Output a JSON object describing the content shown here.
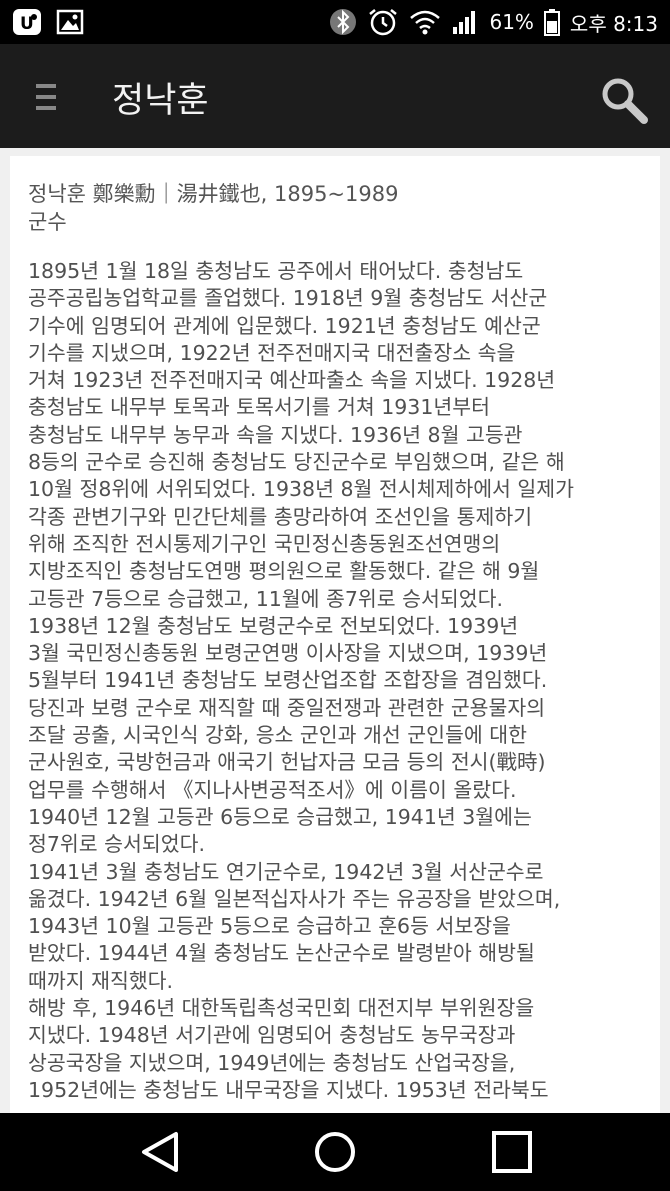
{
  "status_bar": {
    "battery_percent": "61%",
    "time": "오후 8:13",
    "icons": [
      "notification-app-icon",
      "gallery-icon",
      "bluetooth-icon",
      "alarm-icon",
      "wifi-icon",
      "signal-icon",
      "battery-icon"
    ]
  },
  "app_bar": {
    "title": "정낙훈",
    "menu_icon": "hamburger-menu-icon",
    "search_icon": "search-icon"
  },
  "article": {
    "header": "정낙훈 鄭樂勳｜湯井鐵也, 1895~1989",
    "job": "군수",
    "lines": [
      "1895년 1월 18일 충청남도 공주에서 태어났다. 충청남도",
      "공주공립농업학교를 졸업했다. 1918년 9월 충청남도 서산군",
      "기수에 임명되어 관계에 입문했다. 1921년 충청남도 예산군",
      "기수를 지냈으며, 1922년 전주전매지국 대전출장소 속을",
      "거쳐 1923년 전주전매지국 예산파출소 속을 지냈다. 1928년",
      "충청남도 내무부 토목과 토목서기를 거쳐 1931년부터",
      "충청남도 내무부 농무과 속을 지냈다. 1936년 8월 고등관",
      "8등의 군수로 승진해 충청남도 당진군수로 부임했으며, 같은 해",
      "10월 정8위에 서위되었다. 1938년 8월 전시체제하에서 일제가",
      "각종 관변기구와 민간단체를 총망라하여 조선인을 통제하기",
      "위해 조직한 전시통제기구인 국민정신총동원조선연맹의",
      "지방조직인 충청남도연맹 평의원으로 활동했다. 같은 해 9월",
      "고등관 7등으로 승급했고, 11월에 종7위로 승서되었다.",
      "1938년 12월 충청남도 보령군수로 전보되었다. 1939년",
      "3월 국민정신총동원 보령군연맹 이사장을 지냈으며, 1939년",
      "5월부터 1941년 충청남도 보령산업조합 조합장을 겸임했다.",
      "당진과 보령 군수로 재직할 때 중일전쟁과 관련한 군용물자의",
      "조달 공출, 시국인식 강화, 응소 군인과 개선 군인들에 대한",
      "군사원호, 국방헌금과 애국기 헌납자금 모금 등의 전시(戰時)",
      "업무를 수행해서 《지나사변공적조서》에 이름이 올랐다.",
      "1940년 12월 고등관 6등으로 승급했고, 1941년 3월에는",
      "정7위로 승서되었다.",
      "1941년 3월 충청남도 연기군수로, 1942년 3월 서산군수로",
      "옮겼다. 1942년 6월 일본적십자사가 주는 유공장을 받았으며,",
      "1943년 10월 고등관 5등으로 승급하고 훈6등 서보장을",
      "받았다. 1944년 4월 충청남도 논산군수로 발령받아 해방될",
      "때까지 재직했다.",
      "해방 후, 1946년 대한독립촉성국민회 대전지부 부위원장을",
      "지냈다. 1948년 서기관에 임명되어 충청남도 농무국장과",
      "상공국장을 지냈으며, 1949년에는 충청남도 산업국장을,",
      "1952년에는 충청남도 내무국장을 지냈다. 1953년 전라북도"
    ]
  },
  "nav_bar": {
    "buttons": [
      "back-icon",
      "home-icon",
      "recents-icon"
    ]
  }
}
